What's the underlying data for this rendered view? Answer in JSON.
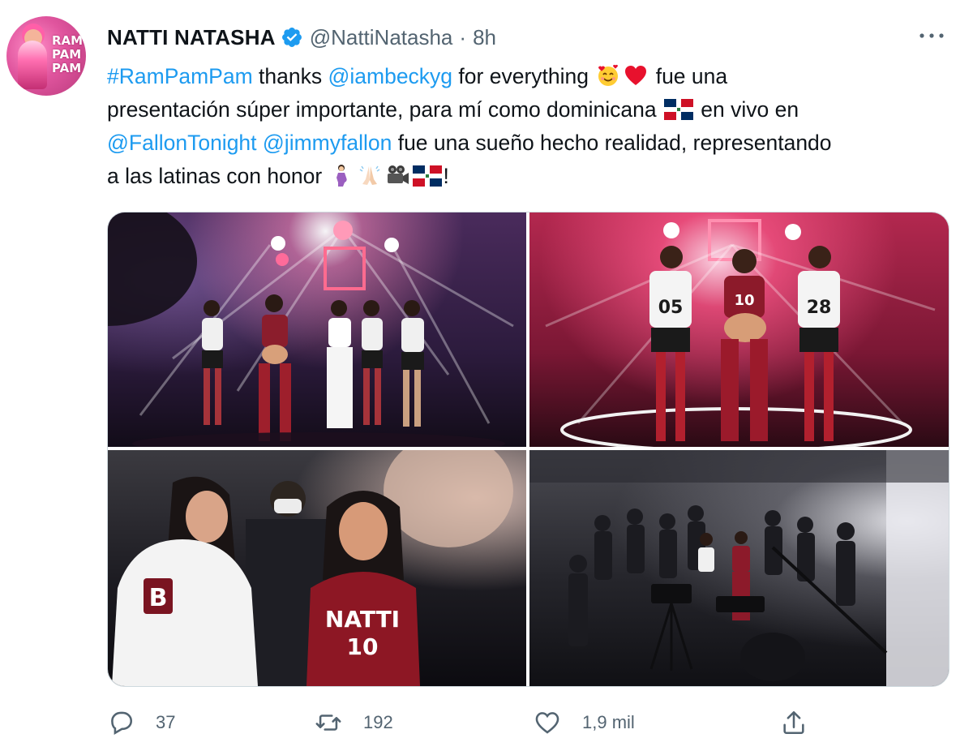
{
  "tweet": {
    "author": {
      "display_name": "NATTI NATASHA",
      "handle": "@NattiNatasha",
      "separator": "·",
      "time": "8h",
      "verified": true,
      "avatar_text": "RAM\nPAM\nPAM"
    },
    "body": {
      "line1": {
        "hashtag": "#RamPamPam",
        "t1": " thanks ",
        "mention1": "@iambeckyg",
        "t2": " for everything ",
        "t3": " fue una"
      },
      "line2": {
        "t1": "presentación súper importante, para mí como dominicana ",
        "t2": " en vivo en"
      },
      "line3": {
        "mention2": "@FallonTonight",
        "t1": " ",
        "mention3": "@jimmyfallon",
        "t2": " fue una sueño hecho realidad, representando"
      },
      "line4": {
        "t1": "a las latinas con honor ",
        "t2": "!"
      },
      "emojis": [
        "smiling-face-with-hearts-icon",
        "red-heart-icon",
        "dominican-flag-icon",
        "pregnant-woman-icon",
        "folded-hands-icon",
        "movie-camera-icon",
        "dominican-flag-icon"
      ]
    },
    "media": {
      "photos": [
        {
          "description_name": "photo-dancers-stage"
        },
        {
          "description_name": "photo-three-performers"
        },
        {
          "description_name": "photo-backstage-duo"
        },
        {
          "description_name": "photo-production-crew"
        }
      ],
      "jersey_numbers": [
        "05",
        "10",
        "28"
      ]
    },
    "actions": {
      "replies": "37",
      "retweets": "192",
      "likes": "1,9 mil"
    },
    "colors": {
      "link": "#1d9bf0",
      "muted": "#536471",
      "verified": "#1d9bf0",
      "text": "#0f1419"
    }
  }
}
